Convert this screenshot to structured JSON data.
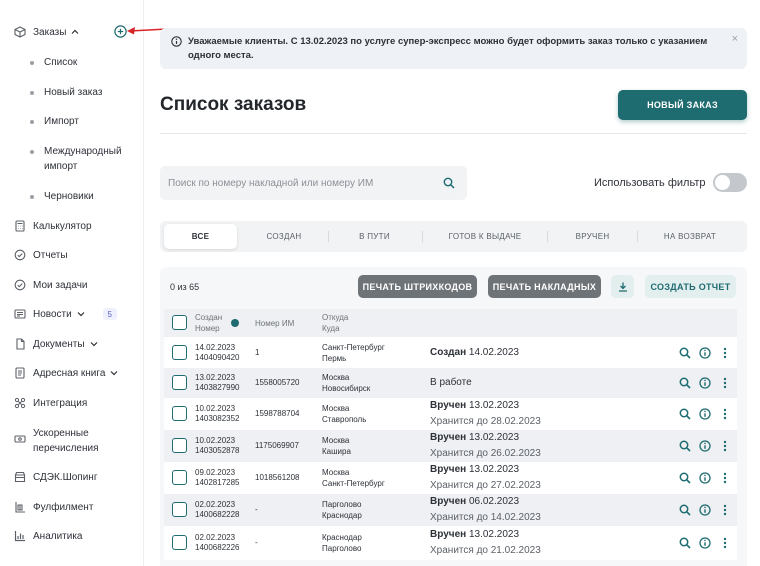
{
  "sidebar": {
    "orders": "Заказы",
    "orders_sub": [
      "Список",
      "Новый заказ",
      "Импорт",
      "Международный импорт",
      "Черновики"
    ],
    "calculator": "Калькулятор",
    "reports": "Отчеты",
    "tasks": "Мои задачи",
    "news": "Новости",
    "news_badge": "5",
    "documents": "Документы",
    "address_book": "Адресная книга",
    "integration": "Интеграция",
    "fast_transfers": "Ускоренные перечисления",
    "shopping": "СДЭК.Шопинг",
    "fulfillment": "Фулфилмент",
    "analytics": "Аналитика"
  },
  "notice": {
    "text": "Уважаемые клиенты. С 13.02.2023 по услуге супер-экспресс можно будет оформить заказ только с указанием одного места.",
    "close": "×"
  },
  "page": {
    "title": "Список заказов",
    "new_order": "НОВЫЙ ЗАКАЗ"
  },
  "search": {
    "placeholder": "Поиск по номеру накладной или номеру ИМ"
  },
  "filter": {
    "label": "Использовать фильтр",
    "enabled": false
  },
  "tabs": [
    "ВСЕ",
    "СОЗДАН",
    "В ПУТИ",
    "ГОТОВ К ВЫДАЧЕ",
    "ВРУЧЕН",
    "НА ВОЗВРАТ"
  ],
  "toolbar": {
    "count": "0 из 65",
    "print_barcodes": "ПЕЧАТЬ ШТРИХКОДОВ",
    "print_waybills": "ПЕЧАТЬ НАКЛАДНЫХ",
    "create_report": "СОЗДАТЬ ОТЧЕТ"
  },
  "table": {
    "headers": {
      "created": "Создан",
      "number": "Номер",
      "im_number": "Номер ИМ",
      "from": "Откуда",
      "to": "Куда"
    },
    "rows": [
      {
        "date": "14.02.2023",
        "num": "1404090420",
        "im": "1",
        "from": "Санкт-Петербург",
        "to": "Пермь",
        "status": "Создан",
        "status_date": "14.02.2023",
        "sub": ""
      },
      {
        "date": "13.02.2023",
        "num": "1403827990",
        "im": "1558005720",
        "from": "Москва",
        "to": "Новосибирск",
        "status": "",
        "status_date": "В работе",
        "sub": ""
      },
      {
        "date": "10.02.2023",
        "num": "1403082352",
        "im": "1598788704",
        "from": "Москва",
        "to": "Ставрополь",
        "status": "Вручен",
        "status_date": "13.02.2023",
        "sub": "Хранится до 28.02.2023"
      },
      {
        "date": "10.02.2023",
        "num": "1403052878",
        "im": "1175069907",
        "from": "Москва",
        "to": "Кашира",
        "status": "Вручен",
        "status_date": "13.02.2023",
        "sub": "Хранится до 26.02.2023"
      },
      {
        "date": "09.02.2023",
        "num": "1402817285",
        "im": "1018561208",
        "from": "Москва",
        "to": "Санкт-Петербург",
        "status": "Вручен",
        "status_date": "13.02.2023",
        "sub": "Хранится до 27.02.2023"
      },
      {
        "date": "02.02.2023",
        "num": "1400682228",
        "im": "-",
        "from": "Парголово",
        "to": "Краснодар",
        "status": "Вручен",
        "status_date": "06.02.2023",
        "sub": "Хранится до 14.02.2023"
      },
      {
        "date": "02.02.2023",
        "num": "1400682226",
        "im": "-",
        "from": "Краснодар",
        "to": "Парголово",
        "status": "Вручен",
        "status_date": "13.02.2023",
        "sub": "Хранится до 21.02.2023"
      }
    ]
  },
  "colors": {
    "accent": "#1e6b70",
    "arrow": "#d9242b",
    "news_badge": "#5b61c6"
  }
}
